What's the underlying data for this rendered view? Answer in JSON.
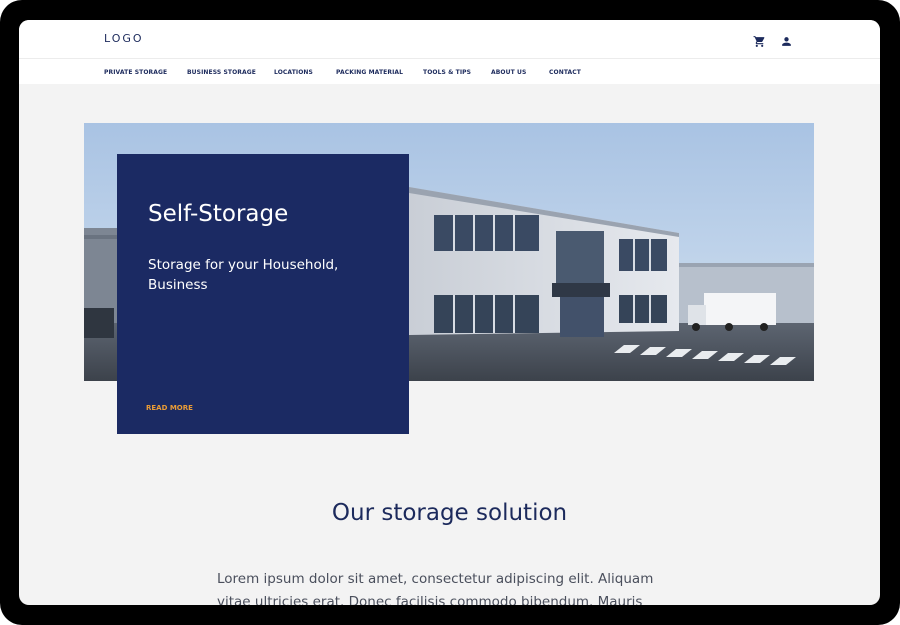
{
  "header": {
    "logo": "LOGO"
  },
  "nav": {
    "items": [
      {
        "label": "PRIVATE STORAGE"
      },
      {
        "label": "BUSINESS STORAGE"
      },
      {
        "label": "LOCATIONS"
      },
      {
        "label": "PACKING MATERIAL"
      },
      {
        "label": "TOOLS & TIPS"
      },
      {
        "label": "ABOUT US"
      },
      {
        "label": "CONTACT"
      }
    ]
  },
  "icons": {
    "cart": "cart-icon",
    "user": "user-icon"
  },
  "hero": {
    "title": "Self-Storage",
    "subtitle": "Storage for your Household, Business",
    "cta": "READ MORE"
  },
  "section": {
    "title": "Our storage solution",
    "body": "Lorem ipsum dolor sit amet, consectetur adipiscing elit. Aliquam vitae ultricies erat. Donec facilisis commodo bibendum. Mauris placerat"
  },
  "colors": {
    "primary": "#1b2a63",
    "accent": "#e99b36",
    "background": "#f3f3f3"
  }
}
